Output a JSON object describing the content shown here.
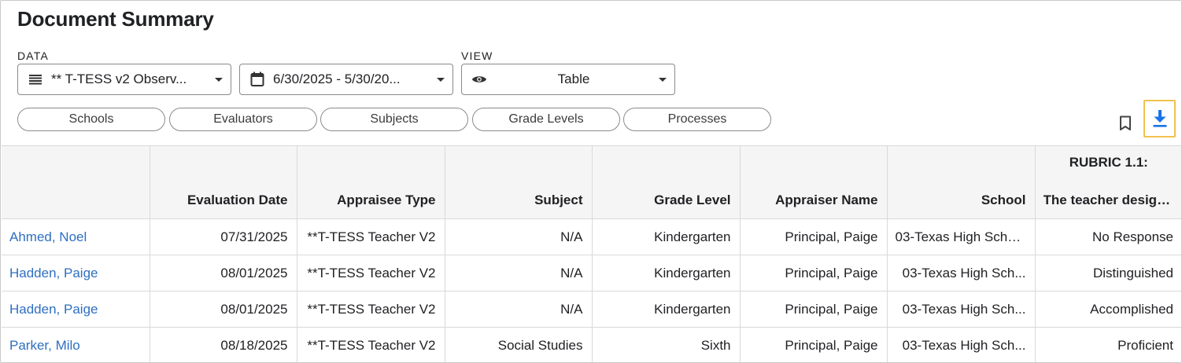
{
  "title": "Document Summary",
  "data_section": {
    "label": "DATA",
    "data_select": {
      "icon": "list-icon",
      "value": "** T-TESS v2 Observ..."
    },
    "date_select": {
      "icon": "calendar-icon",
      "value": "6/30/2025 - 5/30/20..."
    }
  },
  "view_section": {
    "label": "VIEW",
    "view_select": {
      "icon": "eye-icon",
      "value": "Table"
    }
  },
  "filters": [
    "Schools",
    "Evaluators",
    "Subjects",
    "Grade Levels",
    "Processes"
  ],
  "toolbar": {
    "bookmark_icon": "bookmark-icon",
    "download_icon": "download-icon",
    "highlight_color": "#f2c14e"
  },
  "table": {
    "columns": [
      "",
      "Evaluation Date",
      "Appraisee Type",
      "Subject",
      "Grade Level",
      "Appraiser Name",
      "School"
    ],
    "rubric_column": {
      "line1": "RUBRIC 1.1:",
      "line2": "The teacher design..."
    },
    "rows": [
      [
        "Ahmed, Noel",
        "07/31/2025",
        "**T-TESS Teacher V2",
        "N/A",
        "Kindergarten",
        "Principal, Paige",
        "03-Texas High Scho...",
        "No Response"
      ],
      [
        "Hadden, Paige",
        "08/01/2025",
        "**T-TESS Teacher V2",
        "N/A",
        "Kindergarten",
        "Principal, Paige",
        "03-Texas High Sch...",
        "Distinguished"
      ],
      [
        "Hadden, Paige",
        "08/01/2025",
        "**T-TESS Teacher V2",
        "N/A",
        "Kindergarten",
        "Principal, Paige",
        "03-Texas High Sch...",
        "Accomplished"
      ],
      [
        "Parker, Milo",
        "08/18/2025",
        "**T-TESS Teacher V2",
        "Social Studies",
        "Sixth",
        "Principal, Paige",
        "03-Texas High Sch...",
        "Proficient"
      ]
    ]
  },
  "colors": {
    "link": "#2d6fc2",
    "header_bg": "#f5f5f5",
    "border": "#d9d9d9",
    "download_icon": "#1a73e8"
  }
}
